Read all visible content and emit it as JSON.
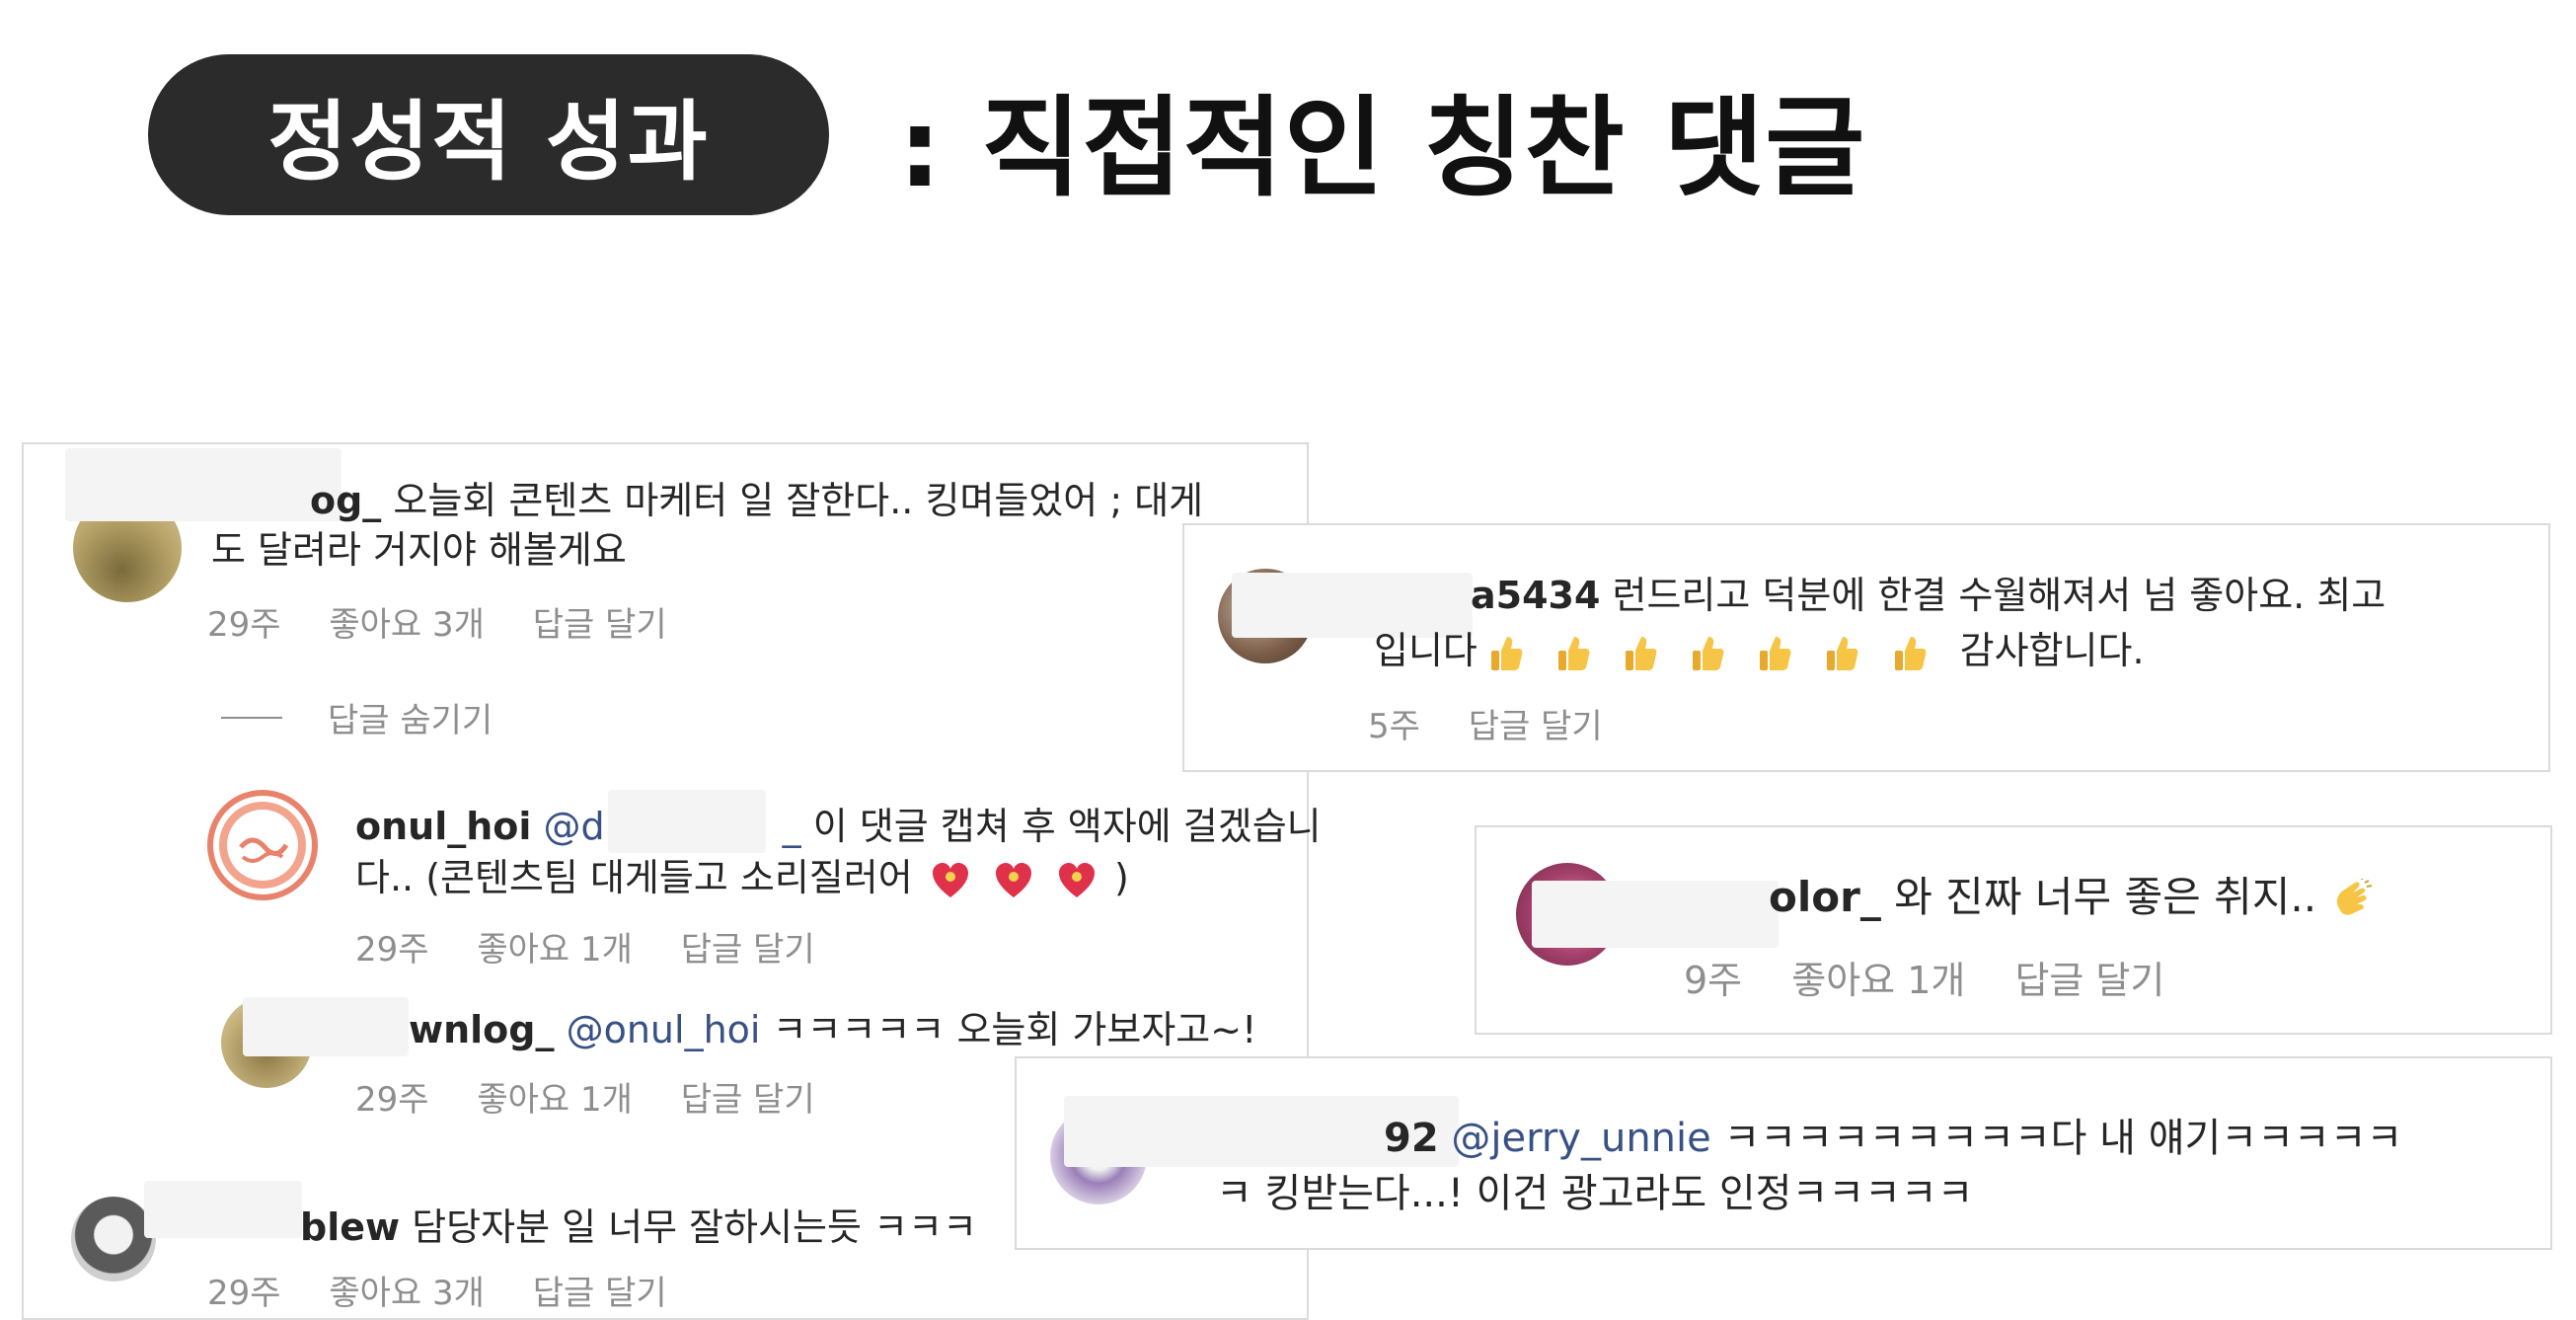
{
  "header": {
    "badge": "정성적 성과",
    "title": ": 직접적인 칭찬 댓글"
  },
  "left_panel": {
    "c1": {
      "username_partial": "og_",
      "line1": "오늘회 콘텐츠 마케터 일 잘한다.. 킹며들었어 ; 대게",
      "line2": "도 달려라 거지야 해볼게요",
      "time": "29주",
      "likes": "좋아요 3개",
      "reply": "답글 달기"
    },
    "hide_replies": "답글 숨기기",
    "c2": {
      "username": "onul_hoi",
      "mention_partial": "@d",
      "mention_tail": "_",
      "line1": "이 댓글 캡쳐 후 액자에 걸겠습니",
      "line2": "다.. (콘텐츠팀 대게들고 소리질러어",
      "line2_end": ")",
      "time": "29주",
      "likes": "좋아요 1개",
      "reply": "답글 달기"
    },
    "c3": {
      "username_partial": "wnlog_",
      "mention": "@onul_hoi",
      "text": "ㅋㅋㅋㅋㅋ 오늘회 가보자고~!",
      "time": "29주",
      "likes": "좋아요 1개",
      "reply": "답글 달기"
    },
    "c4": {
      "username_partial": "blew",
      "text": "담당자분 일 너무 잘하시는듯 ㅋㅋㅋ",
      "time": "29주",
      "likes": "좋아요 3개",
      "reply": "답글 달기"
    }
  },
  "right_panel_1": {
    "username_partial": "a5434",
    "line1": "런드리고 덕분에 한결 수월해져서 넘 좋아요. 최고",
    "line2_start": "입니다",
    "line2_end": "감사합니다.",
    "time": "5주",
    "reply": "답글 달기"
  },
  "right_panel_2": {
    "username_partial": "olor_",
    "text": "와 진짜 너무 좋은 취지..",
    "time": "9주",
    "likes": "좋아요 1개",
    "reply": "답글 달기"
  },
  "right_panel_3": {
    "username_partial": "92",
    "mention": "@jerry_unnie",
    "line1": "ㅋㅋㅋㅋㅋㅋㅋㅋㅋ다 내 얘기ㅋㅋㅋㅋㅋ",
    "line2": "ㅋ 킹받는다...! 이건 광고라도 인정ㅋㅋㅋㅋㅋ"
  },
  "colors": {
    "badge_bg": "#2b2b2b",
    "mention": "#385185",
    "meta_text": "#8e8e8e",
    "panel_border": "#dbdbdb"
  }
}
